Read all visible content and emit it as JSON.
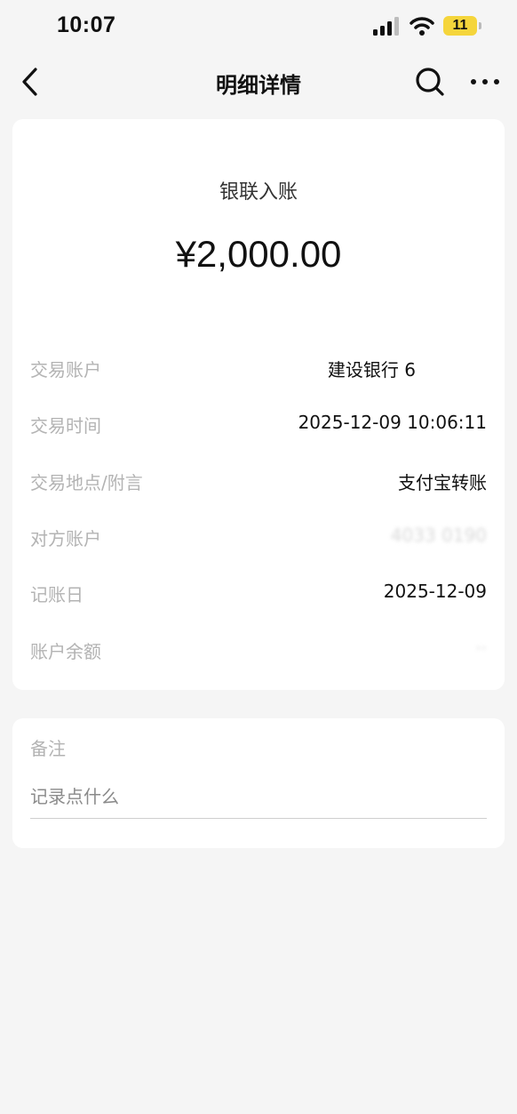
{
  "status": {
    "time": "10:07",
    "battery": "11",
    "battery_color": "#f5d53b"
  },
  "nav": {
    "title": "明细详情",
    "back_icon": "chevron-left-icon",
    "search_icon": "search-icon",
    "more_icon": "more-dots-icon"
  },
  "detail": {
    "type": "银联入账",
    "amount": "¥2,000.00",
    "rows": [
      {
        "label": "交易账户",
        "value": "建设银行 6"
      },
      {
        "label": "交易时间",
        "value": "2025-12-09 10:06:11"
      },
      {
        "label": "交易地点/附言",
        "value": "支付宝转账"
      },
      {
        "label": "对方账户",
        "value": "4033    0190"
      },
      {
        "label": "记账日",
        "value": "2025-12-09"
      },
      {
        "label": "账户余额",
        "value": "··"
      }
    ]
  },
  "notes": {
    "label": "备注",
    "placeholder": "记录点什么"
  }
}
